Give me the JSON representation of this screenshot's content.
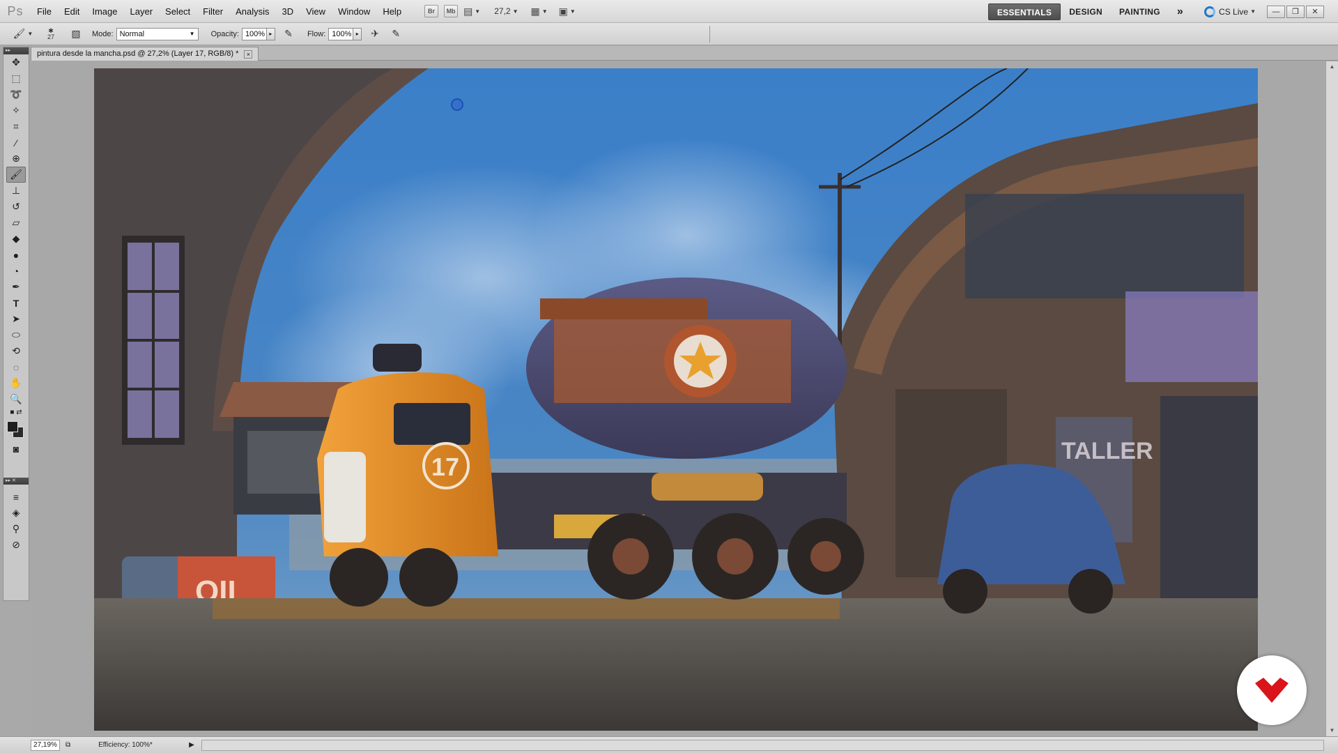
{
  "app": {
    "logo_text": "Ps",
    "menus": [
      "File",
      "Edit",
      "Image",
      "Layer",
      "Select",
      "Filter",
      "Analysis",
      "3D",
      "View",
      "Window",
      "Help"
    ],
    "bridge_label": "Br",
    "minibridge_label": "Mb",
    "zoom_level": "27,2",
    "workspaces": {
      "essentials": "ESSENTIALS",
      "design": "DESIGN",
      "painting": "PAINTING",
      "more": "»"
    },
    "cs_live": "CS Live"
  },
  "options": {
    "brush_size": "27",
    "mode_label": "Mode:",
    "mode_value": "Normal",
    "opacity_label": "Opacity:",
    "opacity_value": "100%",
    "flow_label": "Flow:",
    "flow_value": "100%"
  },
  "document": {
    "tab_title": "pintura desde la mancha.psd @ 27,2% (Layer 17, RGB/8) *",
    "close_glyph": "×"
  },
  "status": {
    "zoom": "27,19%",
    "info": "Efficiency: 100%*"
  },
  "artwork": {
    "truck_number": "17",
    "sign_oil": "OIL",
    "sign_taller": "TALLER"
  },
  "colors": {
    "foreground": "#1f1f1f",
    "background": "#2a2a2a",
    "brand": "#d9141b",
    "sky": "#3f86cf"
  }
}
